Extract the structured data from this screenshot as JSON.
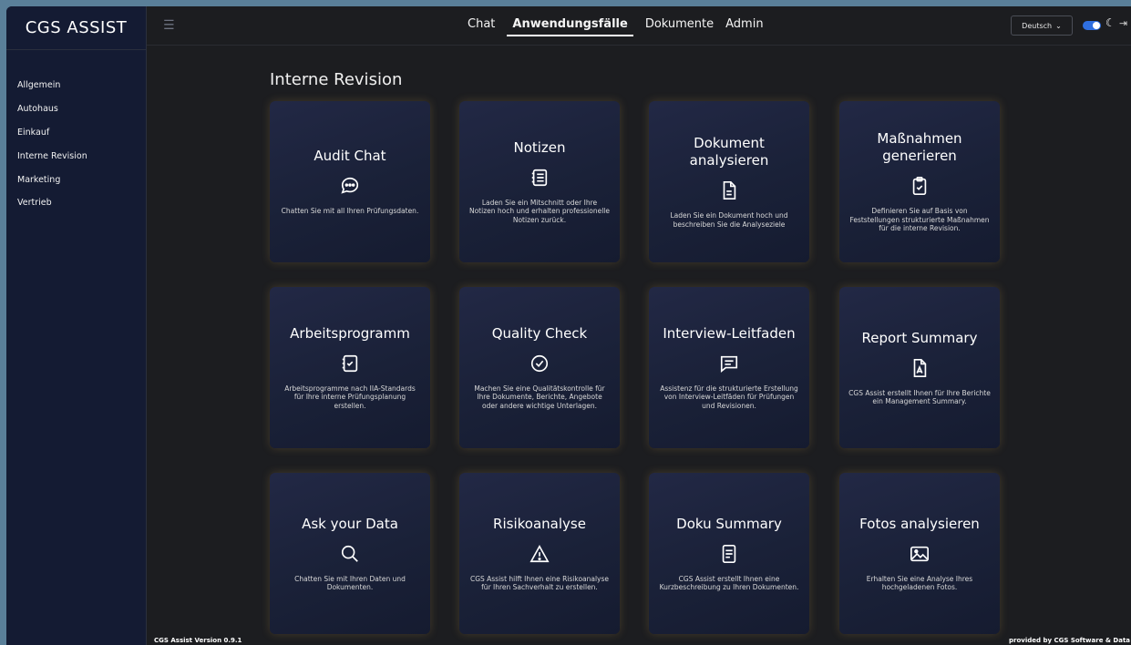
{
  "app": {
    "brand": "CGS ASSIST"
  },
  "sidebar": {
    "items": [
      {
        "label": "Allgemein"
      },
      {
        "label": "Autohaus"
      },
      {
        "label": "Einkauf"
      },
      {
        "label": "Interne Revision"
      },
      {
        "label": "Marketing"
      },
      {
        "label": "Vertrieb"
      }
    ]
  },
  "topnav": {
    "items": [
      {
        "label": "Chat"
      },
      {
        "label": "Anwendungsfälle",
        "active": true
      },
      {
        "label": "Dokumente"
      },
      {
        "label": "Admin"
      }
    ]
  },
  "header": {
    "language": "Deutsch",
    "theme_toggle": "on",
    "accent_color": "#2f6fe0"
  },
  "main": {
    "title": "Interne Revision",
    "cards": [
      {
        "title": "Audit Chat",
        "icon": "chat-bubble-icon",
        "desc": "Chatten Sie mit all Ihren Prüfungsdaten."
      },
      {
        "title": "Notizen",
        "icon": "notes-list-icon",
        "desc": "Laden Sie ein Mitschnitt oder Ihre Notizen hoch und erhalten professionelle Notizen zurück."
      },
      {
        "title": "Dokument analysieren",
        "icon": "document-icon",
        "desc": "Laden Sie ein Dokument hoch und beschreiben Sie die Analyseziele"
      },
      {
        "title": "Maßnahmen generieren",
        "icon": "clipboard-check-icon",
        "desc": "Definieren Sie auf Basis von Feststellungen strukturierte Maßnahmen für die interne Revision."
      },
      {
        "title": "Arbeitsprogramm",
        "icon": "checklist-icon",
        "desc": "Arbeitsprogramme nach IIA-Standards für Ihre interne Prüfungsplanung erstellen."
      },
      {
        "title": "Quality Check",
        "icon": "check-circle-icon",
        "desc": "Machen Sie eine Qualitätskontrolle für Ihre Dokumente, Berichte, Angebote oder andere wichtige Unterlagen."
      },
      {
        "title": "Interview-Leitfaden",
        "icon": "message-text-icon",
        "desc": "Assistenz für die strukturierte Erstellung von Interview-Leitfäden für Prüfungen und Revisionen."
      },
      {
        "title": "Report Summary",
        "icon": "pdf-file-icon",
        "desc": "CGS Assist erstellt Ihnen für Ihre Berichte ein Management Summary."
      },
      {
        "title": "Ask your Data",
        "icon": "search-icon",
        "desc": "Chatten Sie mit Ihren Daten und Dokumenten."
      },
      {
        "title": "Risikoanalyse",
        "icon": "warning-triangle-icon",
        "desc": "CGS Assist hilft Ihnen eine Risikoanalyse für Ihren Sachverhalt zu erstellen."
      },
      {
        "title": "Doku Summary",
        "icon": "file-text-icon",
        "desc": "CGS Assist erstellt Ihnen eine Kurzbeschreibung zu Ihren Dokumenten."
      },
      {
        "title": "Fotos analysieren",
        "icon": "image-icon",
        "desc": "Erhalten Sie eine Analyse Ihres hochgeladenen Fotos."
      }
    ]
  },
  "footer": {
    "version": "CGS Assist Version 0.9.1",
    "provider": "provided by CGS Software & Data"
  }
}
